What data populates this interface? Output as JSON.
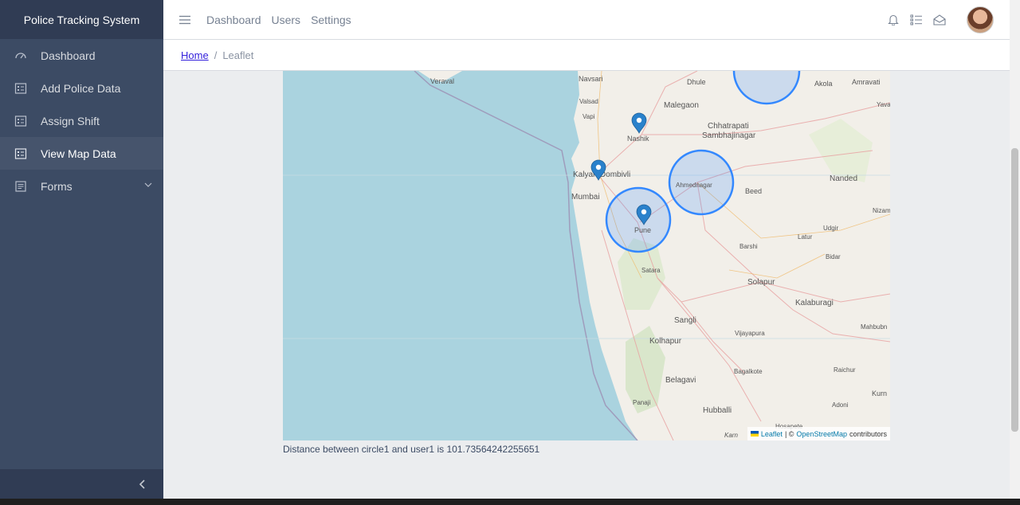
{
  "sidebar": {
    "brand": "Police Tracking System",
    "items": [
      {
        "label": "Dashboard",
        "icon": "speedometer-icon"
      },
      {
        "label": "Add Police Data",
        "icon": "grid-list-icon"
      },
      {
        "label": "Assign Shift",
        "icon": "grid-list-icon"
      },
      {
        "label": "View Map Data",
        "icon": "grid-list-icon"
      },
      {
        "label": "Forms",
        "icon": "notes-icon"
      }
    ],
    "active_item": "View Map Data"
  },
  "header": {
    "nav": [
      "Dashboard",
      "Users",
      "Settings"
    ],
    "icons": [
      "bell-icon",
      "list-icon",
      "envelope-open-icon"
    ]
  },
  "breadcrumb": {
    "home": "Home",
    "separator": "/",
    "current": "Leaflet"
  },
  "map": {
    "labels": {
      "veraval": "Veraval",
      "navsari": "Navsari",
      "dhule": "Dhule",
      "akola": "Akola",
      "amravati": "Amravati",
      "malegaon": "Malegaon",
      "valsad": "Valsad",
      "vapi": "Vapi",
      "yava": "Yava",
      "chhatrapati": "Chhatrapati",
      "sambhajinagar": "Sambhajinagar",
      "nashik": "Nashik",
      "kalyan": "Kalyan-Dombivli",
      "mumbai": "Mumbai",
      "ahmednagar": "Ahmednagar",
      "beed": "Beed",
      "nanded": "Nanded",
      "pune": "Pune",
      "nizam": "Nizam",
      "udgir": "Udgir",
      "latur": "Latur",
      "barshi": "Barshi",
      "bidar": "Bidar",
      "satara": "Satara",
      "solapur": "Solapur",
      "kalaburagi": "Kalaburagi",
      "sangli": "Sangli",
      "vijayapura": "Vijayapura",
      "mahbubn": "Mahbubn",
      "kolhapur": "Kolhapur",
      "bagalkote": "Bagalkote",
      "raichur": "Raichur",
      "belagavi": "Belagavi",
      "kurn": "Kurn",
      "panaji": "Panaji",
      "hubballi": "Hubballi",
      "adoni": "Adoni",
      "hosapete": "Hosapete",
      "karn": "Karn"
    },
    "attribution": {
      "leaflet": "Leaflet",
      "separator": "| ©",
      "osm": "OpenStreetMap",
      "contributors": "contributors"
    },
    "colors": {
      "sea": "#aad3df",
      "land": "#f2efe9",
      "circle_stroke": "#3388ff",
      "marker": "#2a81cb"
    }
  },
  "result": {
    "text": "Distance between circle1 and user1 is 101.73564242255651"
  }
}
